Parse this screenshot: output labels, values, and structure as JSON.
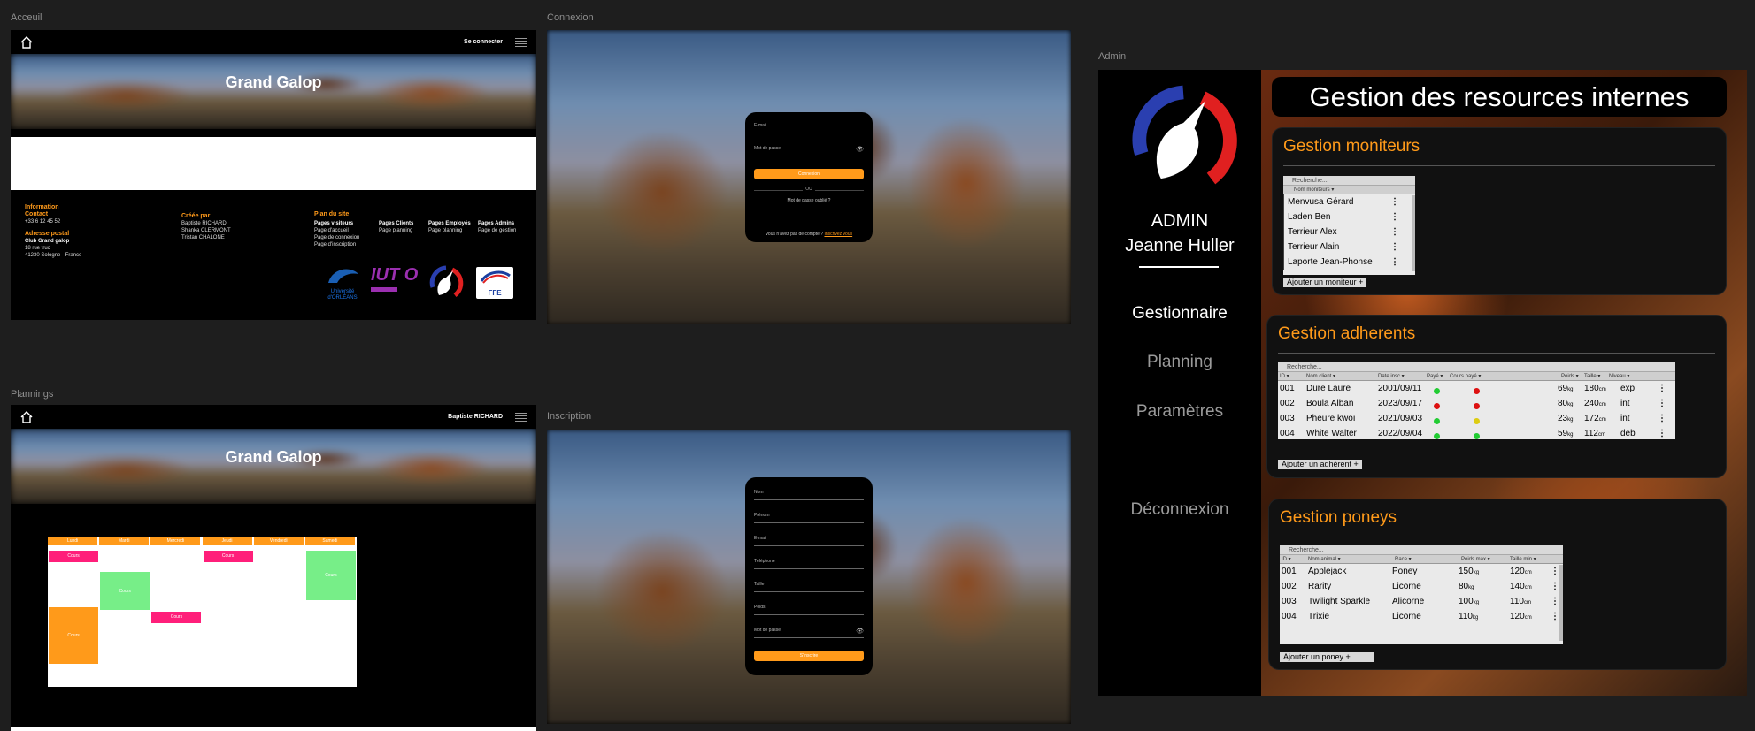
{
  "frames": {
    "accueil": "Acceuil",
    "connexion": "Connexion",
    "admin": "Admin",
    "plannings": "Plannings",
    "inscription": "Inscription"
  },
  "accueil": {
    "login_link": "Se connecter",
    "hero_title": "Grand Galop",
    "footer": {
      "info_title": "Information",
      "contact_title": "Contact",
      "phone": "+33 6 12 45 52",
      "address_title": "Adresse postal",
      "club": "Club Grand galop",
      "street": "18 rue truc",
      "city": "41230 Sologne - France",
      "created_title": "Créée par",
      "authors": [
        "Baptiste RICHARD",
        "Shanka CLERMONT",
        "Tristan CHALONE"
      ],
      "plan_title": "Plan du site",
      "columns": [
        {
          "title": "Pages visiteurs",
          "items": [
            "Page d'accueil",
            "Page de connexion",
            "Page d'inscription"
          ]
        },
        {
          "title": "Pages Clients",
          "items": [
            "Page planning"
          ]
        },
        {
          "title": "Pages Employés",
          "items": [
            "Page planning"
          ]
        },
        {
          "title": "Pages Admins",
          "items": [
            "Page de gestion"
          ]
        }
      ],
      "logos": {
        "univ": "Université d'ORLÉANS",
        "iut": "IUT O",
        "ffe": "FFE"
      }
    }
  },
  "connexion": {
    "email": "E-mail",
    "password": "Mot de passe",
    "submit": "Connexion",
    "or": "OU",
    "forgot": "Mot de passe oublié ?",
    "no_account": "Vous n'avez pas de compte ?",
    "register": "Inscrivez vous"
  },
  "plannings": {
    "user": "Baptiste RICHARD",
    "hero_title": "Grand Galop",
    "days": [
      "Lundi",
      "Mardi",
      "Mercredi",
      "Jeudi",
      "Vendredi",
      "Samedi"
    ],
    "events": [
      {
        "day": 0,
        "label": "Cours",
        "kind": "cours",
        "start": 0.0,
        "end": 0.08
      },
      {
        "day": 1,
        "label": "Cours",
        "kind": "group",
        "start": 0.15,
        "end": 0.42
      },
      {
        "day": 3,
        "label": "Cours",
        "kind": "cours",
        "start": 0.0,
        "end": 0.08
      },
      {
        "day": 2,
        "label": "Cours",
        "kind": "cours",
        "start": 0.43,
        "end": 0.51
      },
      {
        "day": 5,
        "label": "Cours",
        "kind": "group",
        "start": 0.0,
        "end": 0.35
      },
      {
        "day": 0,
        "label": "Cours",
        "kind": "private",
        "start": 0.4,
        "end": 0.8
      }
    ],
    "colors": {
      "cours": "#ff1f7a",
      "group": "#77ee88",
      "private": "#ff9a1a",
      "header": "#ff9a1a"
    }
  },
  "inscription": {
    "fields": [
      "Nom",
      "Prénom",
      "E-mail",
      "Téléphone",
      "Taille",
      "Poids",
      "Mot de passe"
    ],
    "submit": "S'inscrire"
  },
  "admin": {
    "role": "ADMIN",
    "name": "Jeanne Huller",
    "nav": [
      "Gestionnaire",
      "Planning",
      "Paramètres",
      "Déconnexion"
    ],
    "header": "Gestion des resources internes",
    "moniteurs": {
      "title": "Gestion moniteurs",
      "search": "Recherche...",
      "column": "Nom moniteurs ▾",
      "items": [
        "Menvusa Gérard",
        "Laden Ben",
        "Terrieur Alex",
        "Terrieur Alain",
        "Laporte Jean-Phonse"
      ],
      "add": "Ajouter un moniteur  +"
    },
    "adherents": {
      "title": "Gestion adherents",
      "search": "Recherche...",
      "columns": [
        "ID ▾",
        "Nom client ▾",
        "Date insc ▾",
        "Payé ▾",
        "Cours payé ▾",
        "Poids ▾",
        "Taille ▾",
        "Niveau ▾"
      ],
      "rows": [
        {
          "id": "001",
          "name": "Dure Laure",
          "date": "2001/09/11",
          "paid": "green",
          "course": "red",
          "weight": "69",
          "height": "180",
          "level": "exp"
        },
        {
          "id": "002",
          "name": "Boula Alban",
          "date": "2023/09/17",
          "paid": "red",
          "course": "red",
          "weight": "80",
          "height": "240",
          "level": "int"
        },
        {
          "id": "003",
          "name": "Pheure kwoï",
          "date": "2021/09/03",
          "paid": "green",
          "course": "yellow",
          "weight": "23",
          "height": "172",
          "level": "int"
        },
        {
          "id": "004",
          "name": "White Walter",
          "date": "2022/09/04",
          "paid": "green",
          "course": "green",
          "weight": "59",
          "height": "112",
          "level": "deb"
        }
      ],
      "add": "Ajouter un adhérent  +"
    },
    "poneys": {
      "title": "Gestion poneys",
      "search": "Recherche...",
      "columns": [
        "ID ▾",
        "Nom animal ▾",
        "Race ▾",
        "Poids max ▾",
        "Taille min ▾"
      ],
      "rows": [
        {
          "id": "001",
          "name": "Applejack",
          "race": "Poney",
          "weight": "150",
          "height": "120"
        },
        {
          "id": "002",
          "name": "Rarity",
          "race": "Licorne",
          "weight": "80",
          "height": "140"
        },
        {
          "id": "003",
          "name": "Twilight Sparkle",
          "race": "Alicorne",
          "weight": "100",
          "height": "110"
        },
        {
          "id": "004",
          "name": "Trixie",
          "race": "Licorne",
          "weight": "110",
          "height": "120"
        }
      ],
      "add": "Ajouter un poney  +"
    },
    "units": {
      "kg": "kg",
      "cm": "cm"
    },
    "status_colors": {
      "green": "#22cc33",
      "red": "#dd1111",
      "yellow": "#ddcc11"
    }
  }
}
